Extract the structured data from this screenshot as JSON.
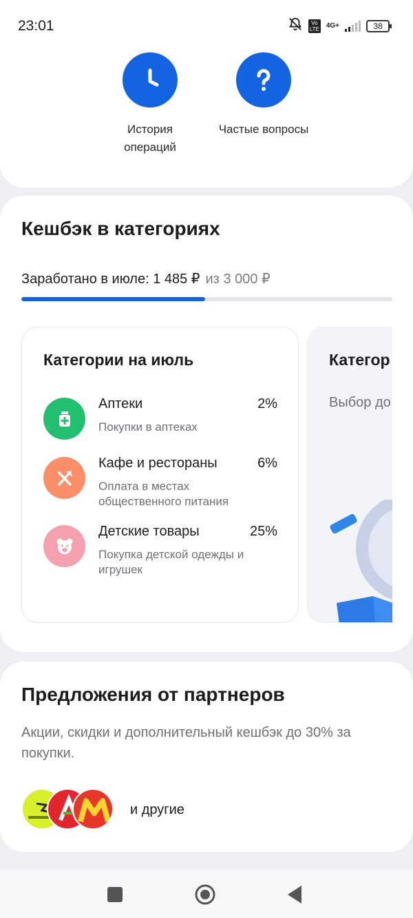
{
  "status_bar": {
    "time": "23:01",
    "network": "4G+",
    "volte": "Vo LTE",
    "battery": "38",
    "icons": [
      "bell-muted-icon",
      "volte-icon",
      "signal-icon",
      "battery-icon"
    ]
  },
  "quick_actions": [
    {
      "label": "История операций",
      "icon": "clock-icon"
    },
    {
      "label": "Частые вопросы",
      "icon": "question-icon"
    }
  ],
  "cashback": {
    "title": "Кешбэк в категориях",
    "earned_label": "Заработано в июле: 1 485 ₽",
    "limit_label": "из 3 000 ₽",
    "progress_fraction": 0.495,
    "card": {
      "title": "Категории на июль",
      "items": [
        {
          "name": "Аптеки",
          "percent": "2%",
          "desc": "Покупки в аптеках",
          "icon": "pharmacy-icon",
          "color": "#21c06e"
        },
        {
          "name": "Кафе и рестораны",
          "percent": "6%",
          "desc": "Оплата в местах общественного питания",
          "icon": "fork-knife-icon",
          "color": "#fc8e6a"
        },
        {
          "name": "Детские товары",
          "percent": "25%",
          "desc": "Покупка детской одежды и игрушек",
          "icon": "teddy-bear-icon",
          "color": "#f5a0ae"
        }
      ]
    },
    "next_card": {
      "title": "Категор",
      "desc": "Выбор до"
    }
  },
  "partners": {
    "title": "Предложения от партнеров",
    "desc": "Акции, скидки и дополнительный кешбэк до 30% за покупки.",
    "others_label": "и другие",
    "logos": [
      "zeleno-logo",
      "auchan-logo",
      "lm-logo"
    ]
  },
  "nav": {
    "buttons": [
      "recent-apps-icon",
      "home-icon",
      "back-icon"
    ]
  },
  "colors": {
    "accent": "#1463e0",
    "background": "#eeeff2"
  }
}
